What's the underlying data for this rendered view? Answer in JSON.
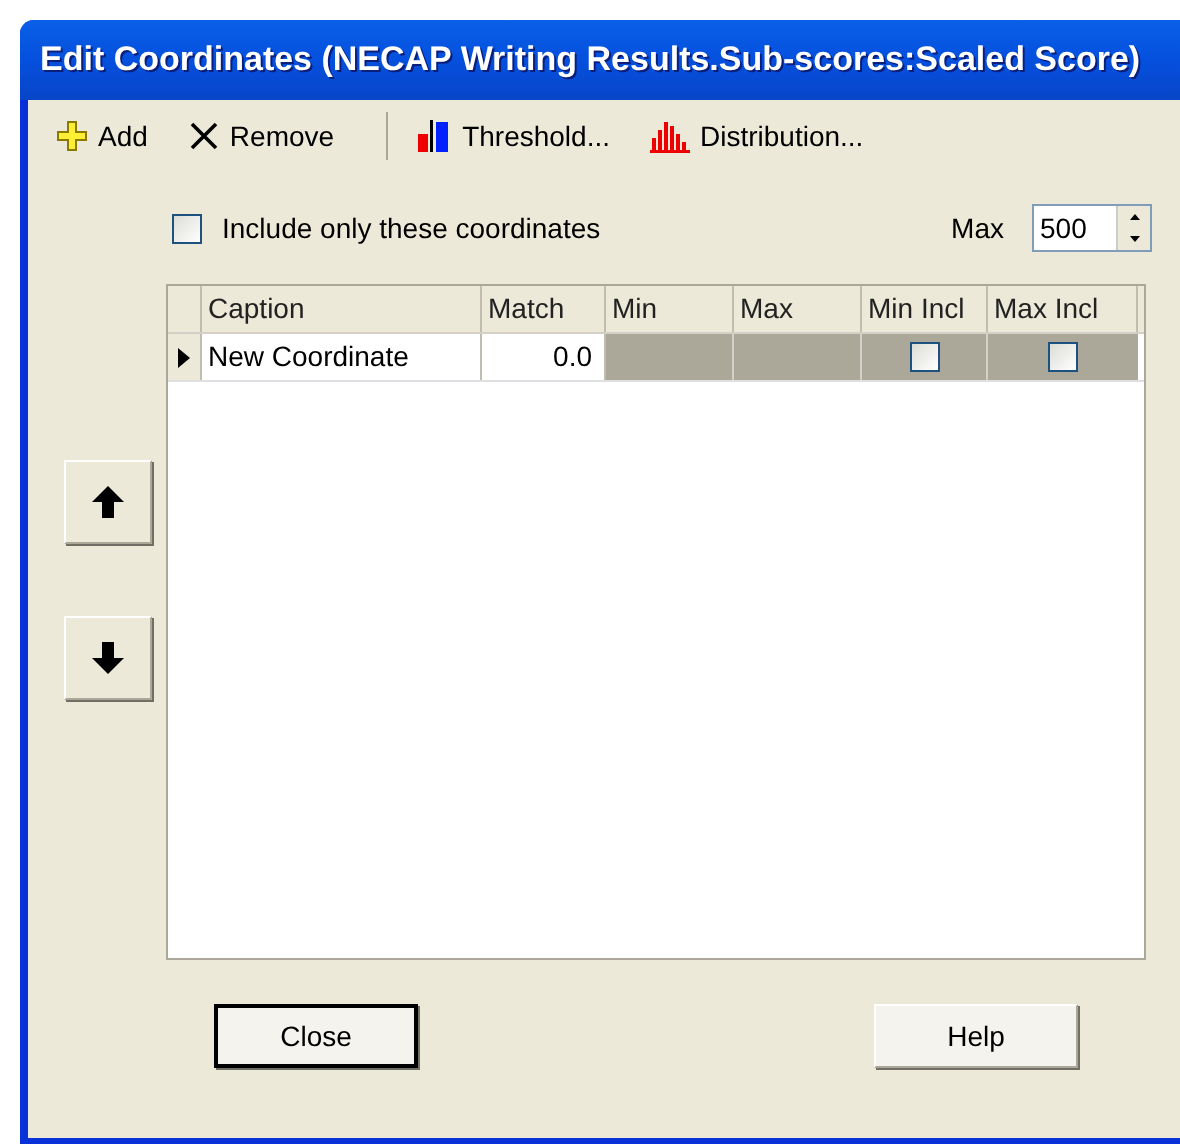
{
  "window": {
    "title": "Edit Coordinates (NECAP Writing Results.Sub-scores:Scaled Score)"
  },
  "toolbar": [
    {
      "kind": "add",
      "label": "Add"
    },
    {
      "kind": "remove",
      "label": "Remove"
    },
    {
      "kind": "threshold",
      "label": "Threshold..."
    },
    {
      "kind": "distribution",
      "label": "Distribution..."
    }
  ],
  "include_only": {
    "label": "Include only these coordinates",
    "checked": false
  },
  "max": {
    "label": "Max",
    "value": "500"
  },
  "table": {
    "columns": [
      "Caption",
      "Match",
      "Min",
      "Max",
      "Min Incl",
      "Max Incl"
    ],
    "rows": [
      {
        "caption": "New Coordinate",
        "match": "0.0",
        "current": true,
        "min_incl": false,
        "max_incl": false
      }
    ]
  },
  "buttons": [
    {
      "label": "Close",
      "default": true
    },
    {
      "label": "Help",
      "default": false
    }
  ]
}
